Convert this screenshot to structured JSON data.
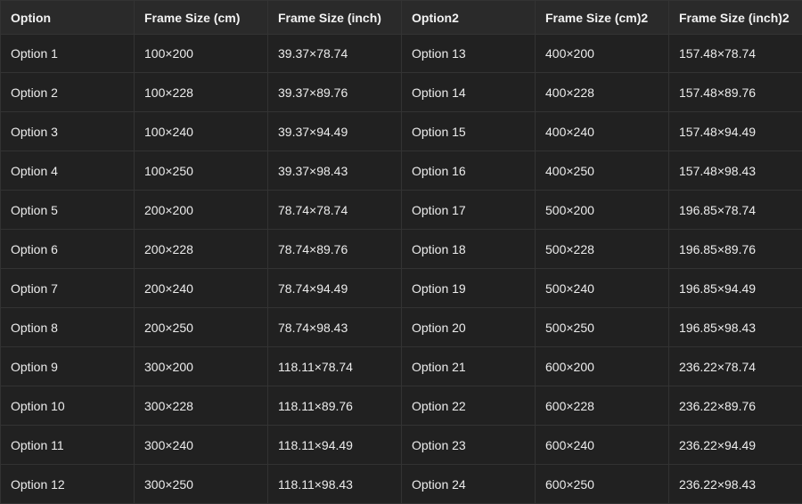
{
  "table": {
    "headers": [
      "Option",
      "Frame Size (cm)",
      "Frame Size (inch)",
      "Option2",
      "Frame Size (cm)2",
      "Frame Size (inch)2"
    ],
    "rows": [
      [
        "Option 1",
        "100×200",
        "39.37×78.74",
        "Option 13",
        "400×200",
        "157.48×78.74"
      ],
      [
        "Option 2",
        "100×228",
        "39.37×89.76",
        "Option 14",
        "400×228",
        "157.48×89.76"
      ],
      [
        "Option 3",
        "100×240",
        "39.37×94.49",
        "Option 15",
        "400×240",
        "157.48×94.49"
      ],
      [
        "Option 4",
        "100×250",
        "39.37×98.43",
        "Option 16",
        "400×250",
        "157.48×98.43"
      ],
      [
        "Option 5",
        "200×200",
        "78.74×78.74",
        "Option 17",
        "500×200",
        "196.85×78.74"
      ],
      [
        "Option 6",
        "200×228",
        "78.74×89.76",
        "Option 18",
        "500×228",
        "196.85×89.76"
      ],
      [
        "Option 7",
        "200×240",
        "78.74×94.49",
        "Option 19",
        "500×240",
        "196.85×94.49"
      ],
      [
        "Option 8",
        "200×250",
        "78.74×98.43",
        "Option 20",
        "500×250",
        "196.85×98.43"
      ],
      [
        "Option 9",
        "300×200",
        "118.11×78.74",
        "Option 21",
        "600×200",
        "236.22×78.74"
      ],
      [
        "Option 10",
        "300×228",
        "118.11×89.76",
        "Option 22",
        "600×228",
        "236.22×89.76"
      ],
      [
        "Option 11",
        "300×240",
        "118.11×94.49",
        "Option 23",
        "600×240",
        "236.22×94.49"
      ],
      [
        "Option 12",
        "300×250",
        "118.11×98.43",
        "Option 24",
        "600×250",
        "236.22×98.43"
      ]
    ]
  }
}
